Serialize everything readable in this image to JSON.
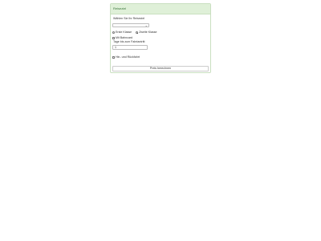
{
  "panel": {
    "title": "Reiseziel"
  },
  "form": {
    "destination_label": "Wählen Sie Ihr Reiseziel",
    "destination_value": "",
    "class_options": [
      {
        "label": "Erste Klasse",
        "checked": false
      },
      {
        "label": "Zweite Klasse",
        "checked": true
      }
    ],
    "bahncard_label": "Mit Bahncard",
    "days_label": "Tage bis zum Fahrtantritt",
    "days_value": "1",
    "roundtrip_label": "Hin- und Rückfahrt",
    "submit_label": "Preis berechnen"
  }
}
